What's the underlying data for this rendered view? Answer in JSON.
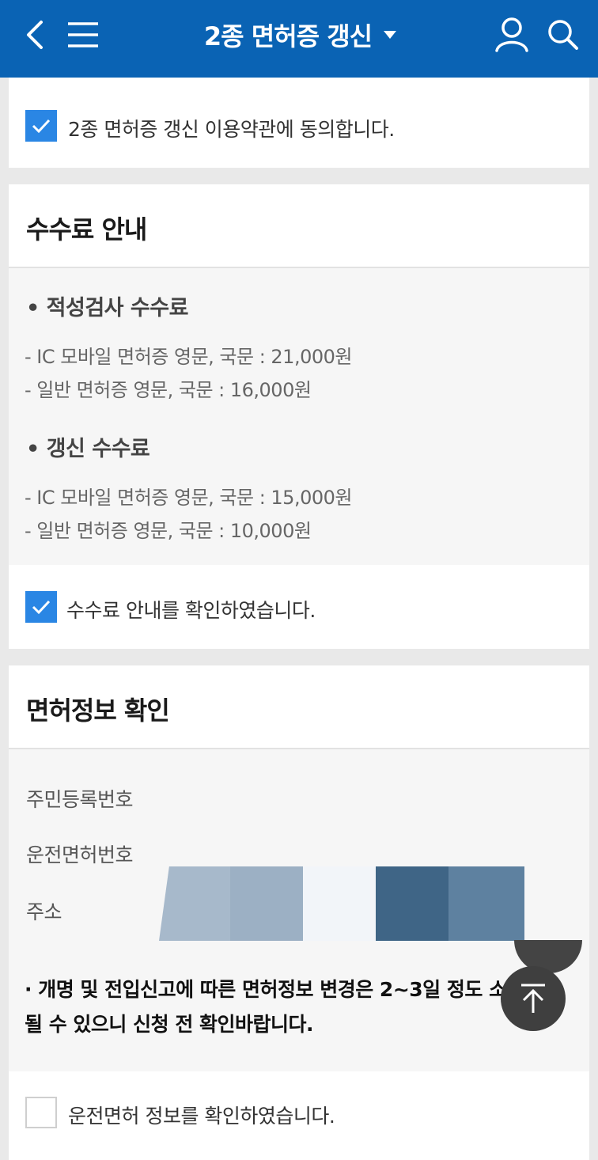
{
  "header": {
    "title": "2종 면허증 갱신",
    "back_icon": "chevron-left-icon",
    "menu_icon": "hamburger-menu-icon",
    "user_icon": "user-icon",
    "search_icon": "search-icon",
    "dropdown_icon": "caret-down-icon",
    "background_color": "#0a63b4"
  },
  "terms": {
    "agree_label": "2종 면허증 갱신 이용약관에 동의합니다.",
    "checked": true
  },
  "fee": {
    "title": "수수료 안내",
    "aptitude_title": "• 적성검사 수수료",
    "aptitude_lines": [
      "- IC 모바일 면허증 영문, 국문 : 21,000원",
      "- 일반 면허증 영문, 국문 : 16,000원"
    ],
    "renewal_title": "• 갱신 수수료",
    "renewal_lines": [
      "- IC 모바일 면허증 영문, 국문 : 15,000원",
      "- 일반 면허증 영문, 국문 : 10,000원"
    ],
    "confirm_label": "수수료 안내를 확인하였습니다.",
    "checked": true
  },
  "license_info": {
    "title": "면허정보 확인",
    "resident_label": "주민등록번호",
    "license_no_label": "운전면허번호",
    "address_label": "주소",
    "notice": "· 개명 및 전입신고에 따른 면허정보 변경은 2~3일 정도 소요될 수 있으니 신청 전 확인바랍니다.",
    "confirm_label": "운전면허 정보를 확인하였습니다.",
    "checked": false
  },
  "colors": {
    "accent": "#2a86e4",
    "scroll_top_button": "#3f3f3f"
  },
  "scroll_top_icon": "arrow-up-icon"
}
